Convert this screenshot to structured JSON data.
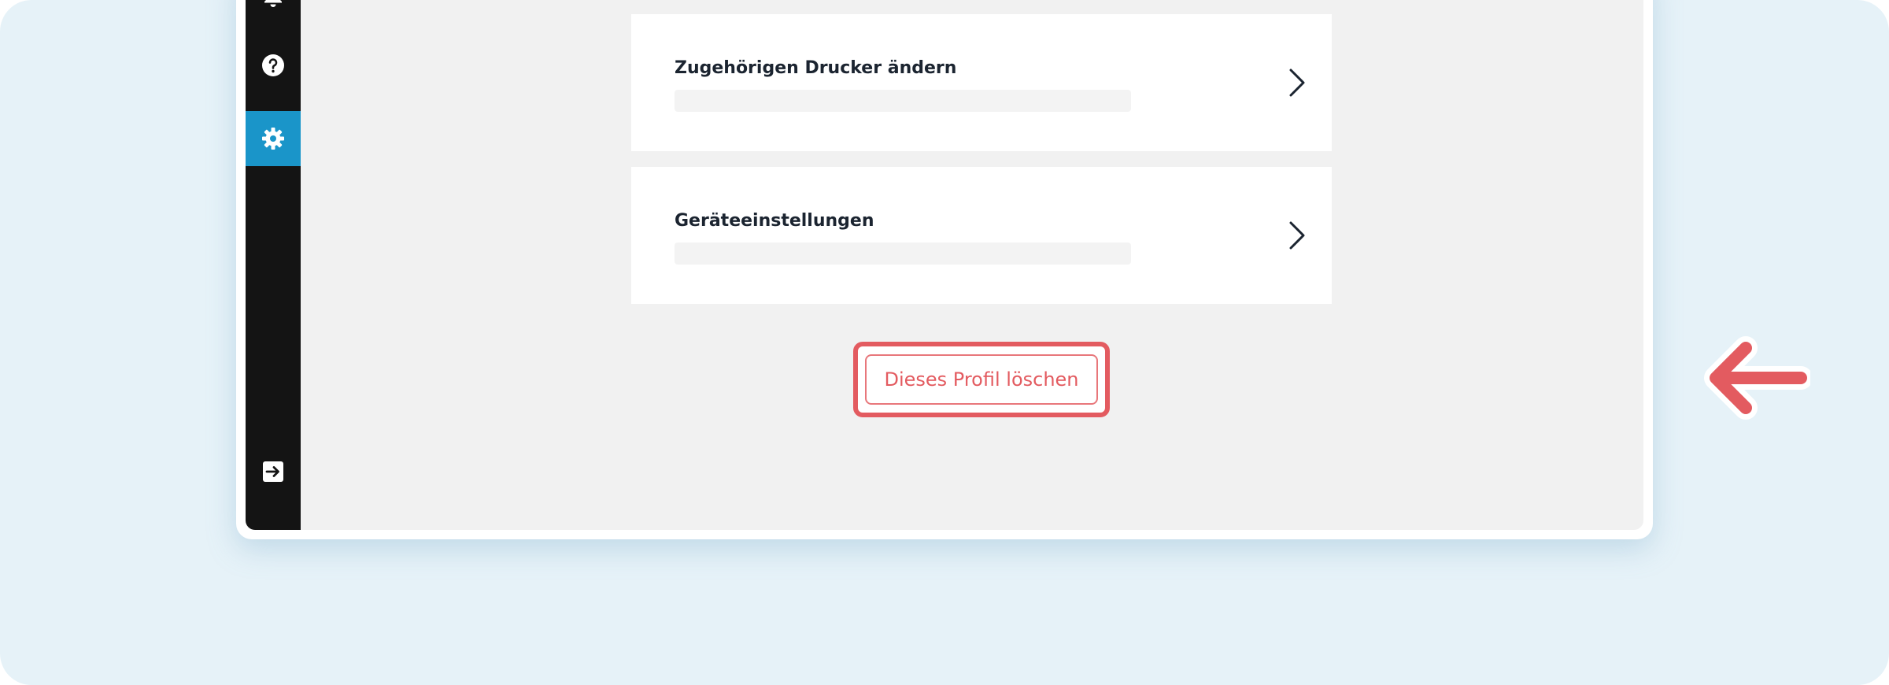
{
  "sidebar": {
    "icons": [
      "bell-icon",
      "help-icon",
      "gear-icon",
      "logout-icon"
    ],
    "active_item": "gear-icon",
    "active_color": "#1a95c9"
  },
  "cards": [
    {
      "title": "Zugehörigen Drucker ändern",
      "subtitle": ""
    },
    {
      "title": "Geräteeinstellungen",
      "subtitle": ""
    }
  ],
  "delete_button": {
    "label": "Dieses Profil löschen",
    "color": "#e35b60"
  },
  "annotation": {
    "icon": "arrow-left-icon",
    "color": "#e35b60"
  }
}
